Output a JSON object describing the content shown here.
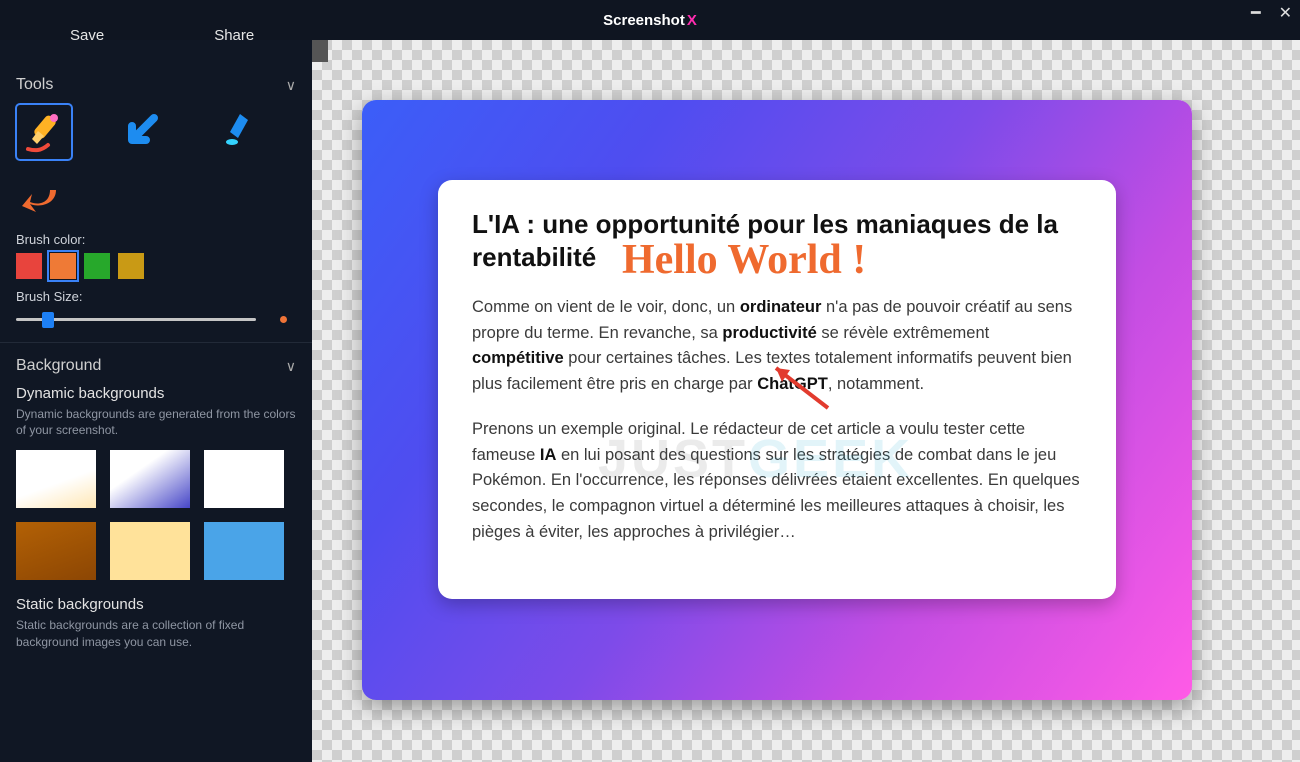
{
  "app": {
    "title_a": "Screenshot",
    "title_b": "X"
  },
  "menu": {
    "save": "Save",
    "share": "Share"
  },
  "tools_section": {
    "title": "Tools"
  },
  "brush": {
    "color_label": "Brush color:",
    "size_label": "Brush Size:",
    "colors": {
      "red": "#e8443d",
      "orange": "#ef7a36",
      "green": "#27a82b",
      "olive": "#c99a15"
    },
    "selected_color": "orange",
    "size_value_pct": 11
  },
  "background": {
    "section_title": "Background",
    "dynamic_title": "Dynamic backgrounds",
    "dynamic_desc": "Dynamic backgrounds are generated from the colors of your screenshot.",
    "static_title": "Static backgrounds",
    "static_desc": "Static backgrounds are a collection of fixed background images you can use."
  },
  "bg_swatches": [
    "linear-gradient(160deg,#ffffff 55%,#ffe7b5 100%)",
    "linear-gradient(145deg,#ffffff 35%,#4646c7 100%)",
    "#ffffff",
    "linear-gradient(160deg,#b36105 0%,#8c4604 100%)",
    "#ffe29a",
    "#4aa4e8"
  ],
  "article": {
    "title": "L'IA : une opportunité pour les maniaques de la rentabilité",
    "p1_a": "Comme on vient de le voir, donc, un ",
    "p1_b1": "ordinateur",
    "p1_c": " n'a pas de pouvoir créatif au sens propre du terme. En revanche, sa ",
    "p1_b2": "productivité",
    "p1_d": " se révèle extrêmement ",
    "p1_b3": "compétitive",
    "p1_e": " pour certaines tâches. Les textes totalement informatifs peuvent bien plus facilement être pris en charge par ",
    "p1_b4": "ChatGPT",
    "p1_f": ", notamment.",
    "p2_a": "Prenons un exemple original. Le rédacteur de cet article a voulu tester cette fameuse ",
    "p2_b1": "IA",
    "p2_c": " en lui posant des questions sur les stratégies de combat dans le jeu Pokémon. En l'occurrence, les réponses délivrées étaient excellentes. En quelques secondes, le compagnon virtuel a déterminé les meilleures attaques à choisir, les pièges à éviter, les approches à privilégier…"
  },
  "annotation": {
    "text": "Hello World !"
  },
  "watermark": {
    "a": "JUST",
    "b": "GEEK"
  }
}
